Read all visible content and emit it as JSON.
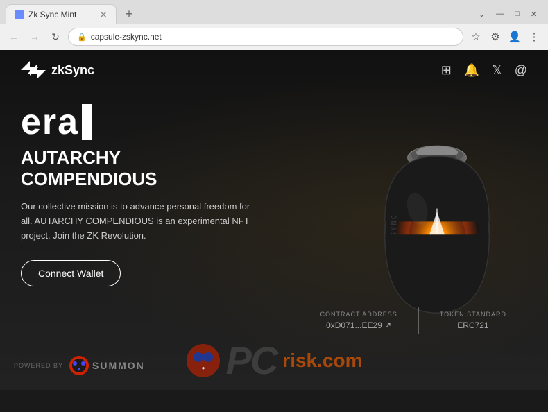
{
  "browser": {
    "tab": {
      "title": "Zk Sync Mint",
      "favicon_label": "tab-favicon"
    },
    "new_tab_label": "+",
    "window_controls": {
      "minimize": "—",
      "maximize": "□",
      "close": "✕"
    },
    "address": "capsule-zskync.net",
    "nav": {
      "back": "←",
      "forward": "→",
      "reload": "↻"
    }
  },
  "site": {
    "nav": {
      "logo_text": "zkSync",
      "social_icons": [
        "discord",
        "bell",
        "twitter",
        "at"
      ]
    },
    "hero": {
      "era_text": "era",
      "title_line1": "AUTARCHY",
      "title_line2": "COMPENDIOUS",
      "description": "Our collective mission is to advance personal freedom for all. AUTARCHY COMPENDIOUS is an experimental NFT project. Join the ZK Revolution.",
      "cta_button": "Connect Wallet"
    },
    "footer": {
      "contract_label": "CONTRACT ADDRESS",
      "contract_value": "0xD071...EE29 ↗",
      "token_label": "TOKEN STANDARD",
      "token_value": "ERC721"
    },
    "powered_by": {
      "label": "POWERED BY",
      "brand": "SUMMON"
    }
  },
  "colors": {
    "background": "#111111",
    "accent": "#ffffff",
    "text_primary": "#ffffff",
    "text_secondary": "#cccccc",
    "brand_orange": "#e85d00"
  }
}
